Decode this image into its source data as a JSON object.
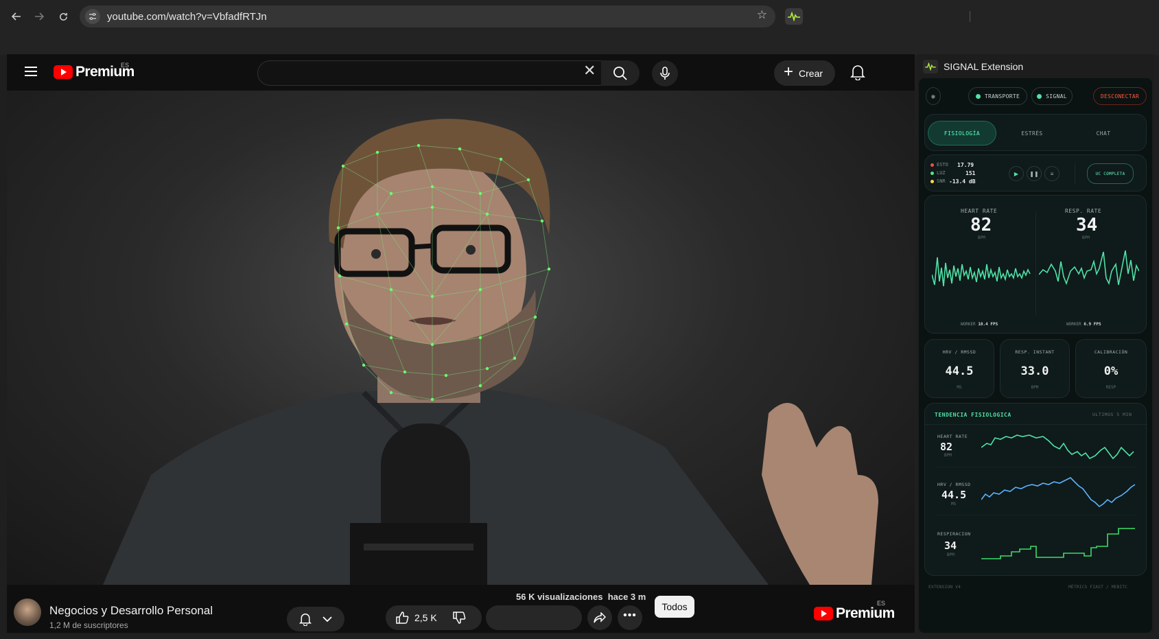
{
  "browser": {
    "url": "youtube.com/watch?v=VbfadfRTJn"
  },
  "youtube": {
    "brand": "Premium",
    "region": "ES",
    "create_label": "Crear",
    "channel_name": "Negocios y Desarrollo Personal",
    "subscribers": "1,2 M de suscriptores",
    "views": "56 K visualizaciones",
    "posted": "hace 3 m",
    "likes": "2,5 K",
    "filter_chip": "Todos"
  },
  "extension": {
    "title": "SIGNAL Extension",
    "chips": {
      "transport": "TRANSPORTE",
      "signal": "SIGNAL",
      "disconnect": "DESCONECTAR"
    },
    "tabs": [
      "FISIOLOGÍA",
      "ESTRÉS",
      "CHAT"
    ],
    "status": [
      {
        "label": "ESTO",
        "value": "17.79",
        "color": "#ff4d4d"
      },
      {
        "label": "LUZ",
        "value": "151",
        "color": "#5fe08a"
      },
      {
        "label": "SNR",
        "value": "-13.4 dB",
        "color": "#ffd84d"
      }
    ],
    "full_button": "UC COMPLETA",
    "vitals": {
      "heart_label": "HEART RATE",
      "heart_value": "82",
      "heart_unit": "BPM",
      "resp_label": "RESP. RATE",
      "resp_value": "34",
      "resp_unit": "BPM",
      "worker_left_label": "WORKER",
      "worker_left_value": "10.4 FPS",
      "worker_right_label": "WORKER",
      "worker_right_value": "6.9 FPS"
    },
    "metrics": [
      {
        "label": "HRV / RMSSD",
        "value": "44.5",
        "unit": "MS"
      },
      {
        "label": "RESP. INSTANT",
        "value": "33.0",
        "unit": "BPM"
      },
      {
        "label": "CALIBRACIÓN",
        "value": "0%",
        "unit": "RESP"
      }
    ],
    "trend": {
      "title": "TENDENCIA FISIOLOGICA",
      "range": "ULTIMOS 5 MIN",
      "rows": [
        {
          "label": "HEART RATE",
          "value": "82",
          "unit": "BPM",
          "color": "#4fe3a8"
        },
        {
          "label": "HRV / RMSSD",
          "value": "44.5",
          "unit": "MS",
          "color": "#5ab4ff"
        },
        {
          "label": "RESPIRACION",
          "value": "34",
          "unit": "BPM",
          "color": "#3ddc6a"
        }
      ]
    },
    "footer_left": "EXTENSION V4",
    "footer_right": "MÉTRICS FIAST / MEBITC",
    "accent": "#4fe3a8"
  }
}
